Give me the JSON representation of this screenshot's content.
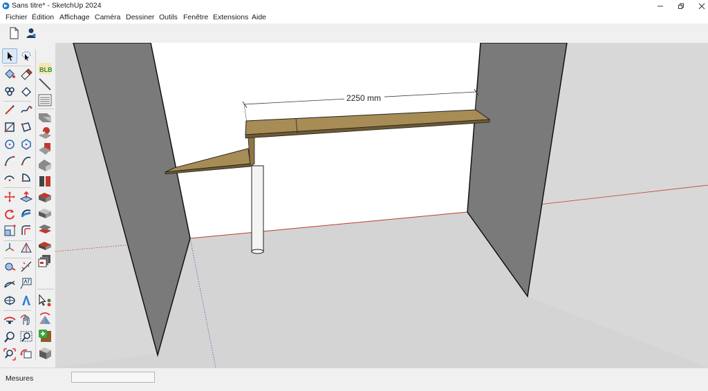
{
  "window": {
    "title": "Sans titre* - SketchUp 2024"
  },
  "menu": [
    "Fichier",
    "Édition",
    "Affichage",
    "Caméra",
    "Dessiner",
    "Outils",
    "Fenêtre",
    "Extensions",
    "Aide"
  ],
  "topbar": {
    "icons": [
      "new-file-icon",
      "user-account-icon"
    ]
  },
  "toolbar": {
    "left_column": [
      "select",
      "orbit-lasso",
      "paint-bucket",
      "eraser",
      "components",
      "tag",
      "pencil",
      "freehand",
      "rectangle",
      "rotated-rectangle",
      "circle",
      "polygon",
      "arc",
      "arc-2pt",
      "arc-3pt",
      "pie",
      "move",
      "push-pull",
      "rotate",
      "follow-me",
      "scale",
      "offset",
      "axes",
      "section-plane",
      "tape-measure",
      "dimension",
      "protractor",
      "text",
      "position-camera",
      "3d-text",
      "walk",
      "look-around",
      "zoom",
      "zoom-window",
      "zoom-extents",
      "previous-view"
    ],
    "right_column": [
      "blb-plugin",
      "layout-lines",
      "list",
      "solid-union",
      "solid-subtract",
      "solid-trim",
      "solid-intersect",
      "solid-split",
      "outer-shell",
      "solid-tools",
      "sandbox",
      "stamp",
      "drape",
      "warehouse",
      "add-location",
      "select-cursor",
      "flip",
      "extension-warehouse",
      "send-to-layout"
    ]
  },
  "viewport": {
    "dimension_label": "2250 mm",
    "axis_colors": {
      "red": "#d04a3e",
      "green": "#3e8a3e",
      "blue": "#3a5fb0"
    }
  },
  "status": {
    "label": "Mesures",
    "value": ""
  }
}
